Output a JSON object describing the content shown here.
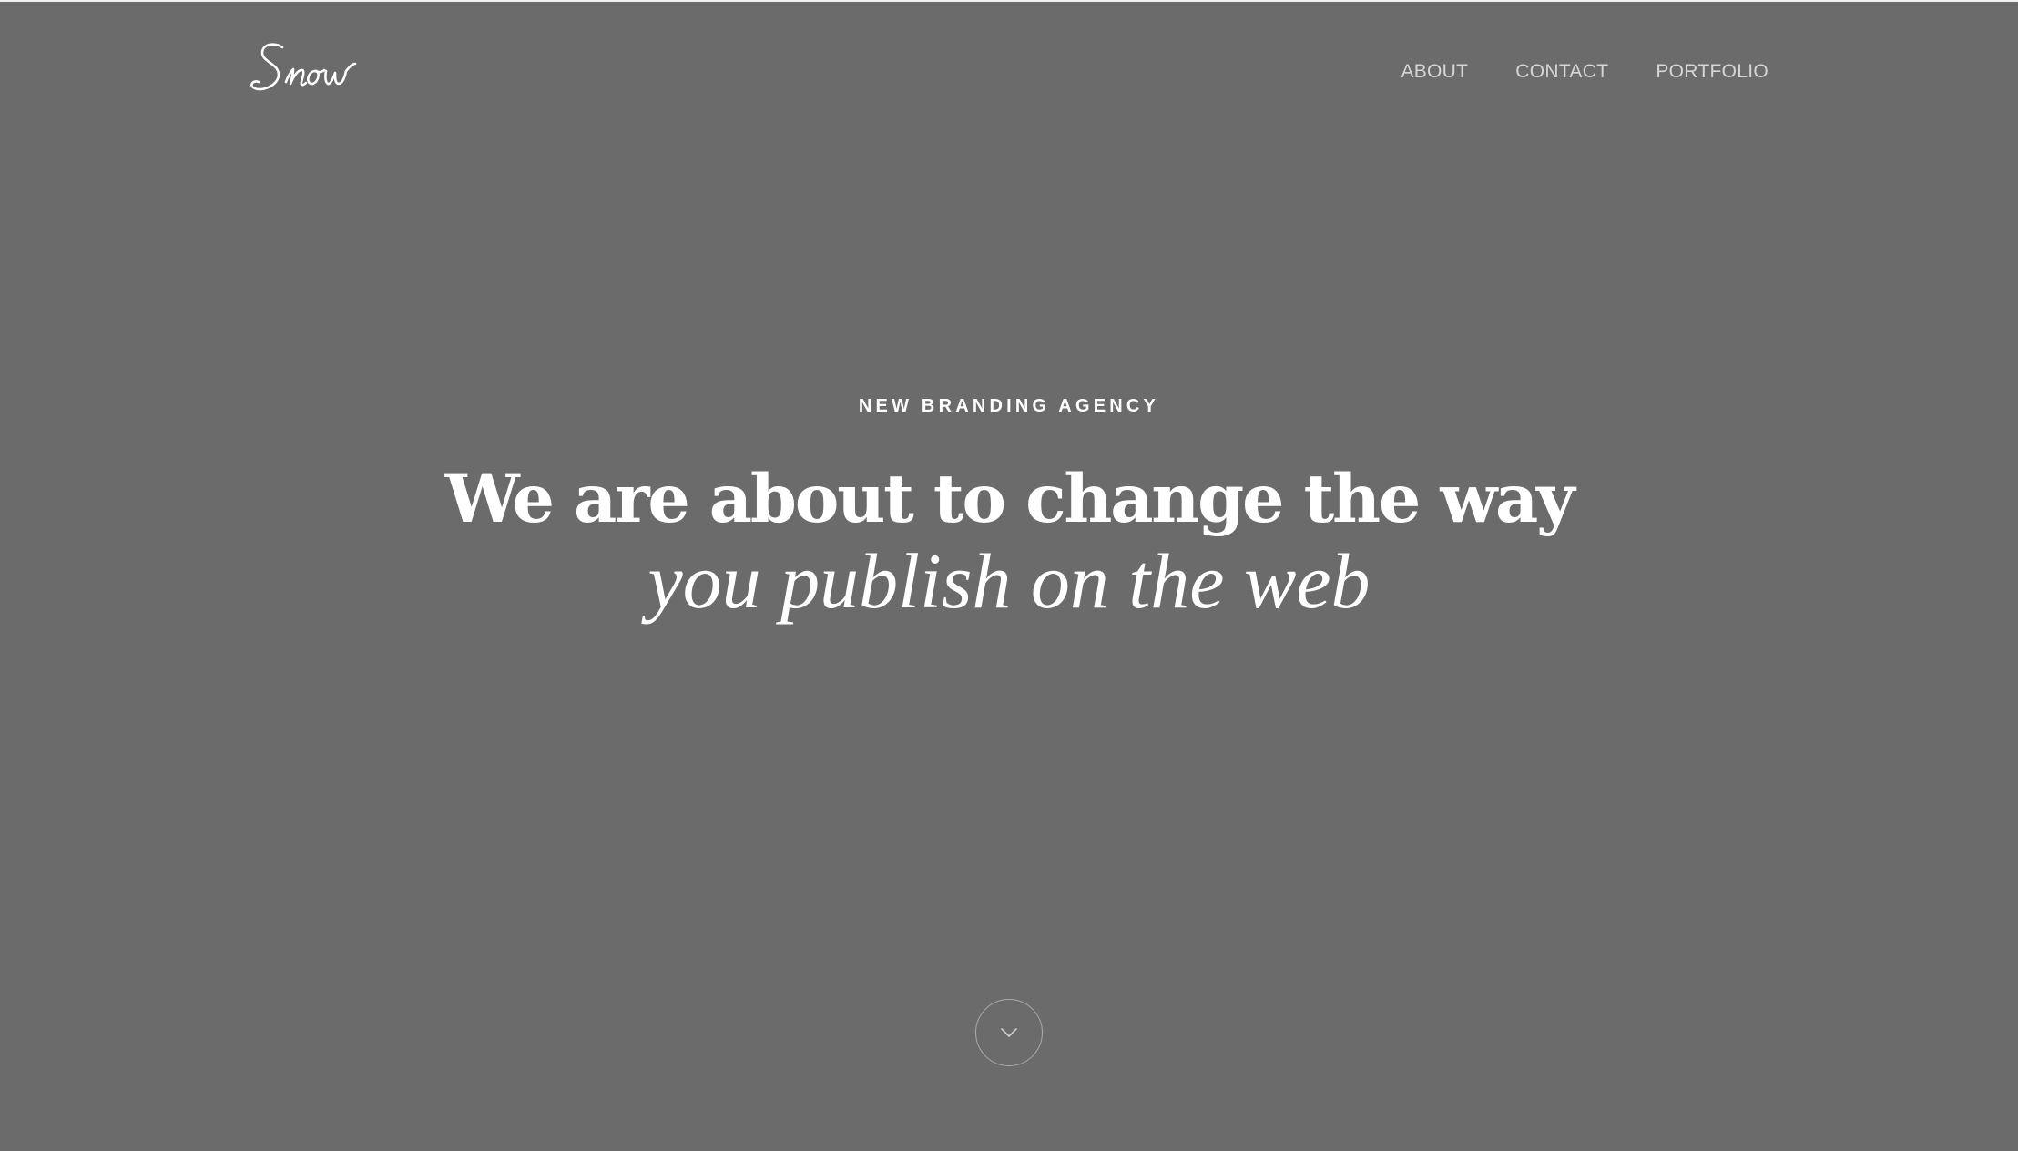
{
  "header": {
    "logo_text": "Snow",
    "nav": [
      {
        "label": "ABOUT"
      },
      {
        "label": "CONTACT"
      },
      {
        "label": "PORTFOLIO"
      }
    ]
  },
  "hero": {
    "eyebrow": "NEW BRANDING AGENCY",
    "headline": "We are about to change the way",
    "subline": "you publish on the web"
  },
  "scroll_button": {
    "icon": "chevron-down-icon"
  },
  "colors": {
    "background": "#6b6b6b",
    "text": "#ffffff",
    "nav_text": "#d6d6d6",
    "circle_border": "#a9a9a9"
  }
}
